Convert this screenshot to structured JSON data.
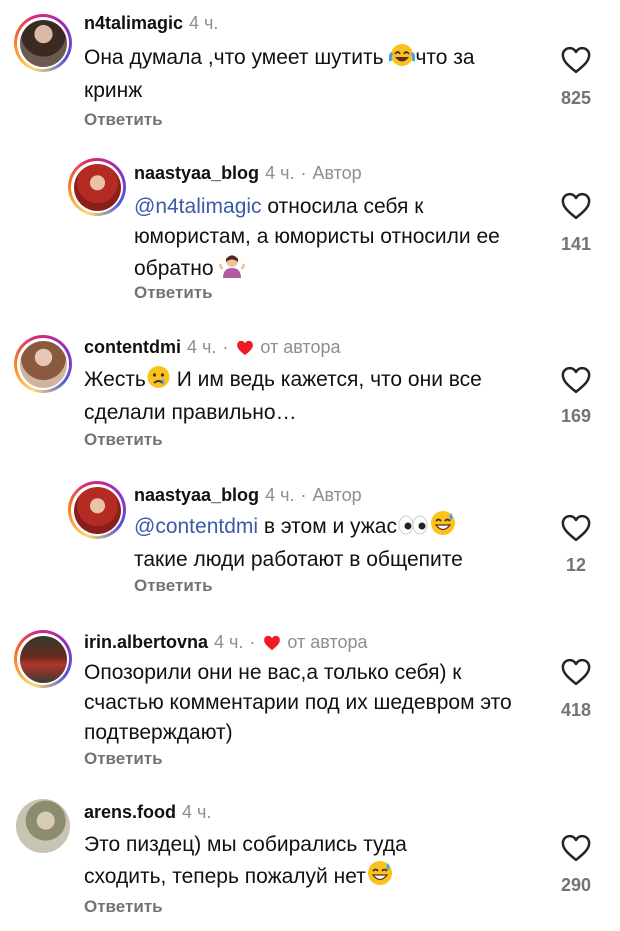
{
  "comments": [
    {
      "username": "n4talimagic",
      "time": "4 ч.",
      "text": "Она думала ,что умеет шутить",
      "text_after": "что за кринж",
      "likes": "825",
      "reply": "Ответить"
    },
    {
      "username": "naastyaa_blog",
      "time": "4 ч.",
      "separator": "·",
      "author_label": "Автор",
      "mention": "@n4talimagic",
      "text": " относила себя к юмористам, а юмористы относили ее обратно",
      "likes": "141",
      "reply": "Ответить"
    },
    {
      "username": "contentdmi",
      "time": "4 ч.",
      "separator": "·",
      "liked_by_author": "от автора",
      "text_before": "Жесть",
      "text": " И им ведь кажется, что они все сделали правильно…",
      "likes": "169",
      "reply": "Ответить"
    },
    {
      "username": "naastyaa_blog",
      "time": "4 ч.",
      "separator": "·",
      "author_label": "Автор",
      "mention": "@contentdmi",
      "text": " в этом и ужас",
      "text_after": "такие люди работают в общепите",
      "likes": "12",
      "reply": "Ответить"
    },
    {
      "username": "irin.albertovna",
      "time": "4 ч.",
      "separator": "·",
      "liked_by_author": "от автора",
      "text": "Опозорили они не вас,а только себя) к счастью комментарии под их шедевром это подтверждают)",
      "likes": "418",
      "reply": "Ответить"
    },
    {
      "username": "arens.food",
      "time": "4 ч.",
      "text": "Это пиздец) мы собирались туда сходить, теперь пожалуй нет",
      "likes": "290",
      "reply": "Ответить"
    }
  ],
  "icons": {
    "like": "heart-outline-icon",
    "author_like": "heart-filled-icon",
    "author_like_color": "#ed1c24"
  }
}
